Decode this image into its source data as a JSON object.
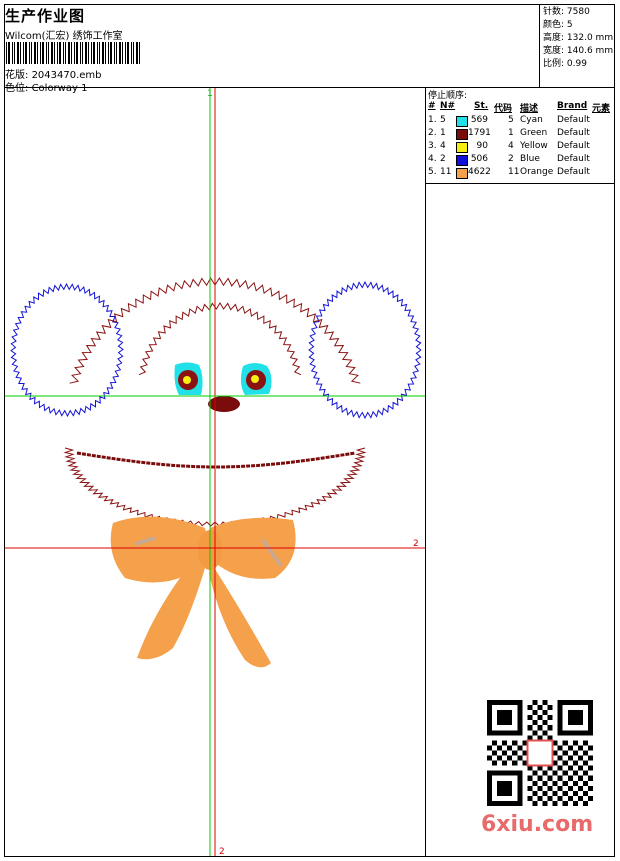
{
  "header": {
    "title": "生产作业图",
    "subtitle": "Wilcom(汇宏) 绣饰工作室",
    "file_label": "花版:",
    "file_name": "2043470.emb",
    "colorway_label": "色位:",
    "colorway": "Colorway 1"
  },
  "stats": {
    "stitches_label": "针数:",
    "stitches": "7580",
    "colors_label": "颜色:",
    "colors": "5",
    "height_label": "高度:",
    "height": "132.0 mm",
    "width_label": "宽度:",
    "width": "140.6 mm",
    "scale_label": "比例:",
    "scale": "0.99"
  },
  "stop_sequence": {
    "title": "停止顺序:",
    "headers": [
      "#",
      "N#",
      "St.",
      "代码",
      "描述",
      "Brand",
      "元素"
    ],
    "rows": [
      {
        "idx": "1.",
        "n": "5",
        "color": "#22e0e8",
        "st": "569",
        "code": "5",
        "desc": "Cyan",
        "brand": "Default"
      },
      {
        "idx": "2.",
        "n": "1",
        "color": "#7a0c0c",
        "st": "1791",
        "code": "1",
        "desc": "Green",
        "brand": "Default"
      },
      {
        "idx": "3.",
        "n": "4",
        "color": "#f5ee10",
        "st": "90",
        "code": "4",
        "desc": "Yellow",
        "brand": "Default"
      },
      {
        "idx": "4.",
        "n": "2",
        "color": "#1010d8",
        "st": "506",
        "code": "2",
        "desc": "Blue",
        "brand": "Default"
      },
      {
        "idx": "5.",
        "n": "11",
        "color": "#f5a04a",
        "st": "4622",
        "code": "11",
        "desc": "Orange",
        "brand": "Default"
      }
    ]
  },
  "guides": {
    "v_label_top": "1",
    "v_label_bottom": "2",
    "h_label": "2"
  },
  "watermark": "6xiu.com",
  "colors": {
    "guide_green": "#00cc00",
    "guide_red": "#dd0000"
  }
}
